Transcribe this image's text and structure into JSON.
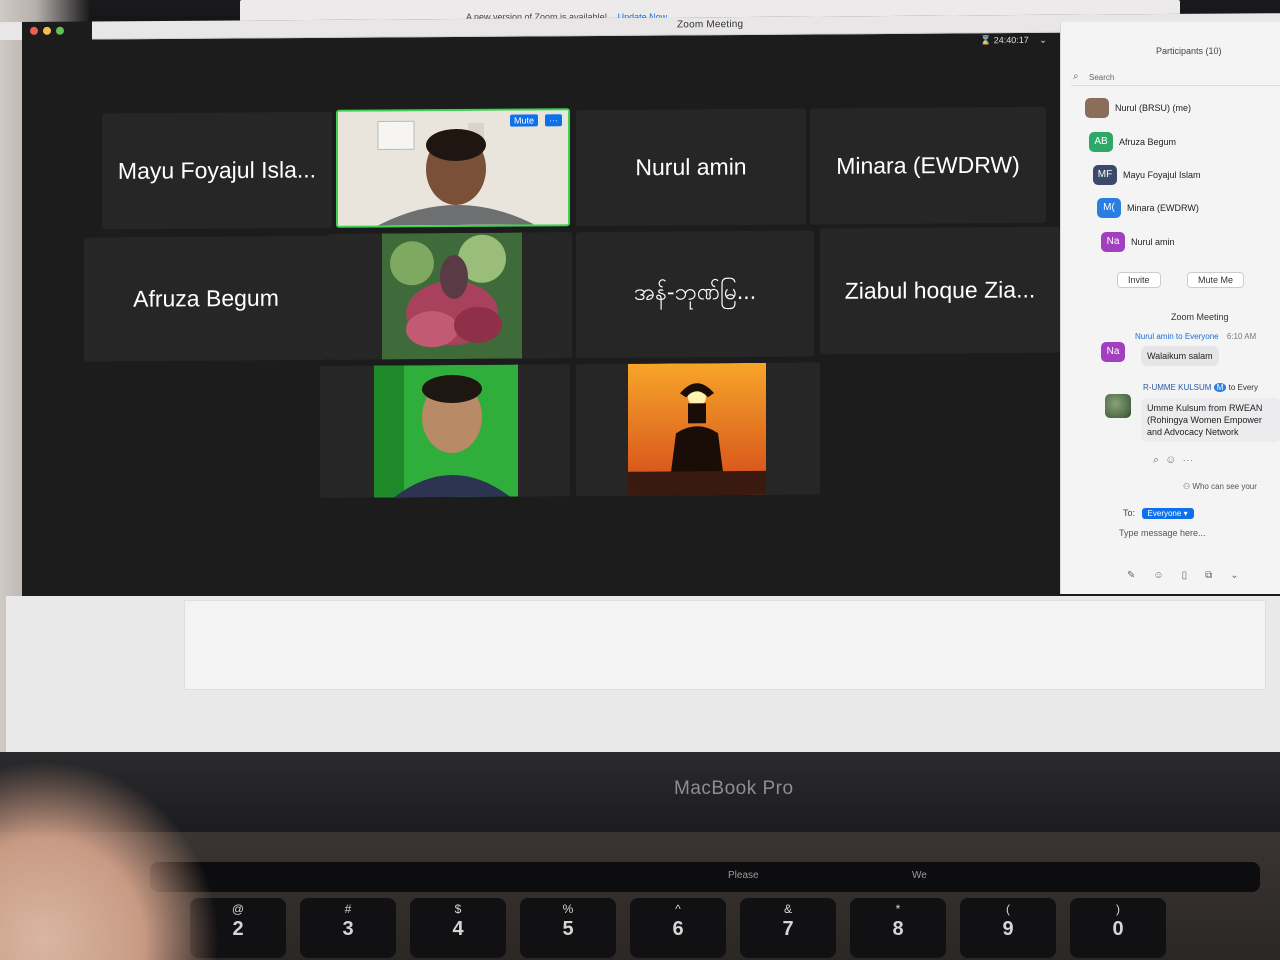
{
  "banner": {
    "text": "A new version of Zoom is available!",
    "link": "Update Now"
  },
  "window": {
    "title": "Zoom Meeting",
    "timer": "24:40:17"
  },
  "tiles": [
    {
      "name": "Mayu Foyajul Isla..."
    },
    {
      "name": "Nurul amin"
    },
    {
      "name": "Minara (EWDRW)"
    },
    {
      "name": "Afruza Begum"
    },
    {
      "name": "အန်-ဘုဏ်မြ..."
    },
    {
      "name": "Ziabul hoque Zia..."
    }
  ],
  "active_tile": {
    "mute_label": "Mute",
    "more_label": "···"
  },
  "participants_panel": {
    "title": "Participants (10)",
    "search_placeholder": "Search",
    "participants": [
      {
        "initials": "",
        "name": "Nurul (BRSU) (me)",
        "color": "#8a6d5a"
      },
      {
        "initials": "AB",
        "name": "Afruza Begum",
        "color": "#2ea866"
      },
      {
        "initials": "MF",
        "name": "Mayu Foyajul Islam",
        "color": "#3b4a6b"
      },
      {
        "initials": "M(",
        "name": "Minara (EWDRW)",
        "color": "#2a7de1"
      },
      {
        "initials": "Na",
        "name": "Nurul amin",
        "color": "#a23fbf"
      }
    ],
    "invite_label": "Invite",
    "mute_me_label": "Mute Me"
  },
  "chat": {
    "title": "Zoom Meeting",
    "messages": [
      {
        "from": "Nurul amin",
        "to_text": "to Everyone",
        "time": "6:10 AM",
        "avatar_initials": "Na",
        "text": "Walaikum salam"
      },
      {
        "from": "R-UMME KULSUM",
        "badge": "M",
        "to_text": "to Every",
        "lines": [
          "Umme Kulsum from RWEAN",
          "(Rohingya Women Empower",
          "and Advocacy Network"
        ]
      }
    ],
    "who_can_see": "Who can see your",
    "to_label": "To:",
    "to_value": "Everyone",
    "input_placeholder": "Type message here..."
  },
  "device": {
    "label": "MacBook Pro",
    "touchbar_texts": [
      "Please",
      "We"
    ],
    "keys": [
      {
        "sym": "@",
        "num": "2"
      },
      {
        "sym": "#",
        "num": "3"
      },
      {
        "sym": "$",
        "num": "4"
      },
      {
        "sym": "%",
        "num": "5"
      },
      {
        "sym": "^",
        "num": "6"
      },
      {
        "sym": "&",
        "num": "7"
      },
      {
        "sym": "*",
        "num": "8"
      },
      {
        "sym": "(",
        "num": "9"
      },
      {
        "sym": ")",
        "num": "0"
      }
    ]
  }
}
